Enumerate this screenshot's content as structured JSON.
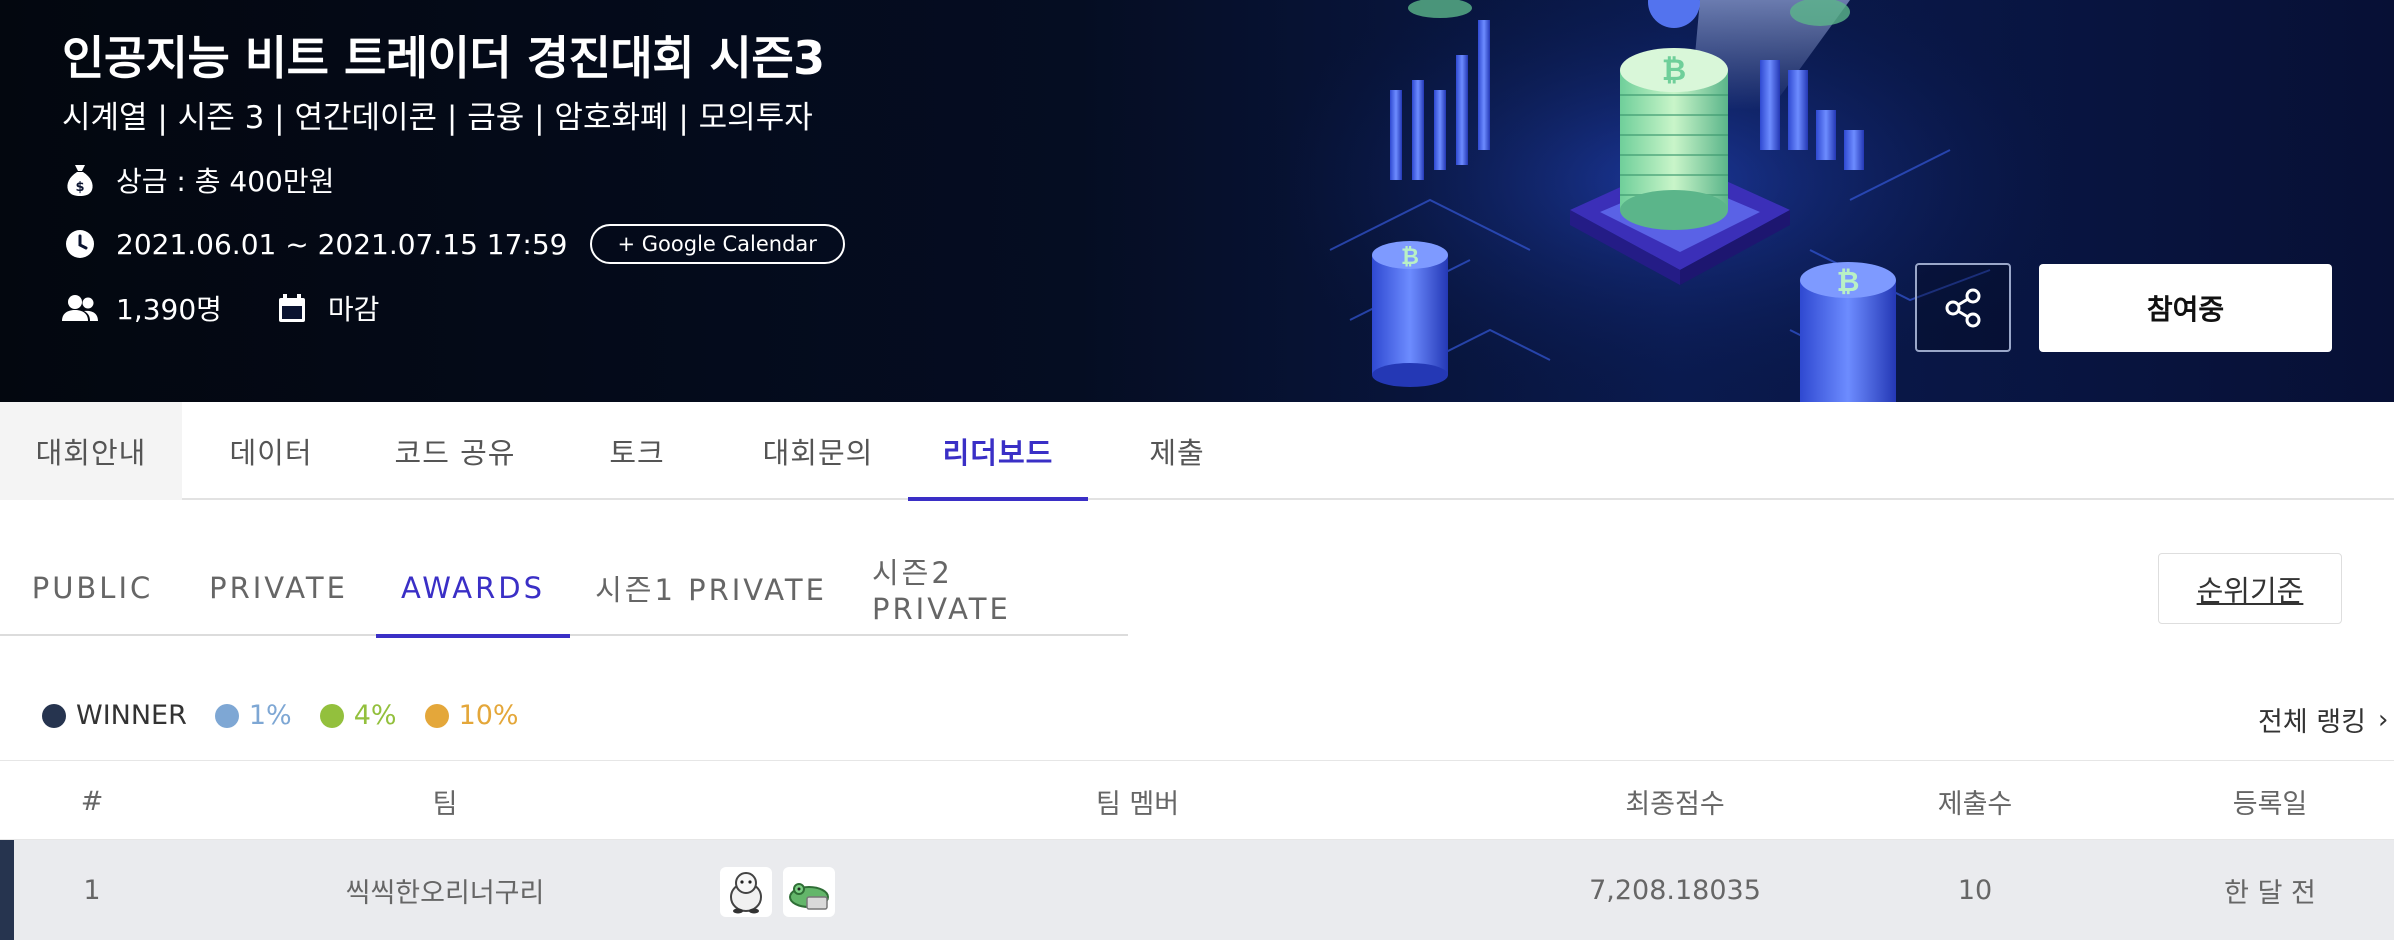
{
  "banner": {
    "title": "인공지능 비트 트레이더 경진대회 시즌3",
    "subtitle": "시계열 | 시즌 3 | 연간데이콘 | 금융 | 암호화폐 | 모의투자",
    "prize": "상금 : 총 400만원",
    "period": "2021.06.01 ~ 2021.07.15 17:59",
    "google_calendar_label": "+ Google Calendar",
    "participants": "1,390명",
    "status": "마감",
    "join_label": "참여중",
    "icons": {
      "prize": "money-bag-icon",
      "period": "clock-icon",
      "participants": "people-icon",
      "status": "calendar-icon",
      "share": "share-icon"
    }
  },
  "main_tabs": [
    {
      "label": "대회안내"
    },
    {
      "label": "데이터"
    },
    {
      "label": "코드 공유"
    },
    {
      "label": "토크"
    },
    {
      "label": "대회문의"
    },
    {
      "label": "리더보드"
    },
    {
      "label": "제출"
    }
  ],
  "main_tabs_active": "리더보드",
  "leaderboard": {
    "sub_tabs": [
      {
        "label": "PUBLIC"
      },
      {
        "label": "PRIVATE"
      },
      {
        "label": "AWARDS"
      },
      {
        "label": "시즌1 PRIVATE"
      },
      {
        "label": "시즌2 PRIVATE"
      }
    ],
    "sub_tabs_active": "AWARDS",
    "rank_basis_label": "순위기준",
    "legend": [
      {
        "label": "WINNER",
        "color": "#26344f",
        "text_color": "#333333"
      },
      {
        "label": "1%",
        "color": "#7ea7d4",
        "text_color": "#7ea7d4"
      },
      {
        "label": "4%",
        "color": "#93c03d",
        "text_color": "#93c03d"
      },
      {
        "label": "10%",
        "color": "#e4a73a",
        "text_color": "#e4a73a"
      }
    ],
    "full_ranking_label": "전체 랭킹",
    "columns": [
      "#",
      "팀",
      "팀 멤버",
      "최종점수",
      "제출수",
      "등록일"
    ],
    "rows": [
      {
        "rank": "1",
        "team": "씩씩한오리너구리",
        "score": "7,208.18035",
        "submissions": "10",
        "registered": "한 달 전",
        "tier": "WINNER"
      }
    ]
  },
  "colors": {
    "accent": "#3a2fc6",
    "winner": "#26344f"
  }
}
